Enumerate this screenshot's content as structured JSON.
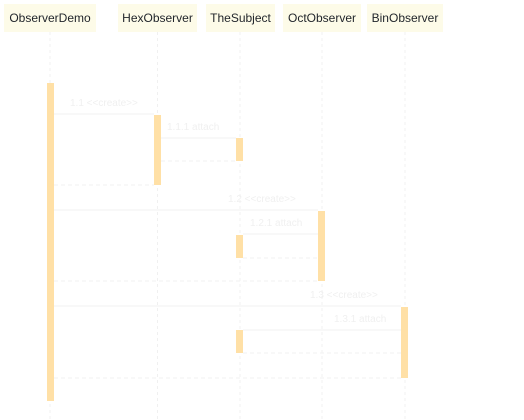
{
  "participants": [
    {
      "id": "observer-demo",
      "label": "ObserverDemo"
    },
    {
      "id": "hex-observer",
      "label": "HexObserver"
    },
    {
      "id": "the-subject",
      "label": "TheSubject"
    },
    {
      "id": "oct-observer",
      "label": "OctObserver"
    },
    {
      "id": "bin-observer",
      "label": "BinObserver"
    }
  ],
  "messages": [
    {
      "id": "msg-1-1",
      "label": "1.1 <<create>>"
    },
    {
      "id": "msg-1-1-1",
      "label": "1.1.1 attach"
    },
    {
      "id": "msg-1-2",
      "label": "1.2 <<create>>"
    },
    {
      "id": "msg-1-2-1",
      "label": "1.2.1 attach"
    },
    {
      "id": "msg-1-3",
      "label": "1.3 <<create>>"
    },
    {
      "id": "msg-1-3-1",
      "label": "1.3.1 attach"
    }
  ],
  "colors": {
    "header_fill": "#fdfbe8",
    "activation_fill": "#ffe0a6",
    "line": "#f2f2f2"
  }
}
